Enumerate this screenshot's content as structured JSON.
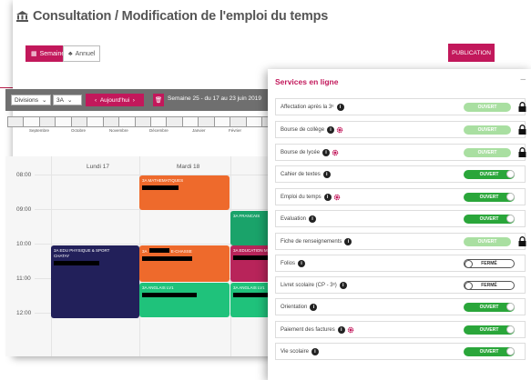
{
  "header": {
    "title": "Consultation / Modification de l'emploi du temps"
  },
  "view_toggle": {
    "week_label": "Semaine",
    "year_label": "Annuel"
  },
  "publish_label": "PUBLICATION",
  "toolbar": {
    "divisions_label": "Divisions",
    "class_value": "3A",
    "today_label": "Aujourd'hui",
    "week_text": "Semaine 25 - du 17 au 23 juin 2019"
  },
  "timeline": {
    "months": [
      "Septembre",
      "Octobre",
      "Novembre",
      "Décembre",
      "Janvier",
      "Février"
    ]
  },
  "calendar": {
    "days": [
      "Lundi 17",
      "Mardi 18"
    ],
    "hours": [
      "08:00",
      "09:00",
      "10:00",
      "11:00",
      "12:00"
    ],
    "events": [
      {
        "title": "3A MATHEMATIQUES",
        "color": "#ee6a2c"
      },
      {
        "title": "3A FRANCAIS",
        "color": "#1aa36a"
      },
      {
        "title": "3A EDU PHYSIQUE & SPORT",
        "sub": "CHATAY",
        "color": "#22205a"
      },
      {
        "title": "3A",
        "sub": "E-CHASSE",
        "color": "#ee6a2c"
      },
      {
        "title": "3A EDUCATION M",
        "color": "#b8245a"
      },
      {
        "title": "3A ANGLAIS LV1",
        "color": "#1fc27b"
      },
      {
        "title": "3A ANGLAIS LV1",
        "color": "#1fc27b"
      }
    ]
  },
  "panel": {
    "title": "Services en ligne",
    "services": [
      {
        "name": "Affectation après la 3ᵉ",
        "info": true,
        "gear": false,
        "status": "OUVERT",
        "state": "locked"
      },
      {
        "name": "Bourse de collège",
        "info": true,
        "gear": true,
        "status": "OUVERT",
        "state": "locked"
      },
      {
        "name": "Bourse de lycée",
        "info": true,
        "gear": true,
        "status": "OUVERT",
        "state": "locked"
      },
      {
        "name": "Cahier de textes",
        "info": true,
        "gear": false,
        "status": "OUVERT",
        "state": "open"
      },
      {
        "name": "Emploi du temps",
        "info": true,
        "gear": true,
        "status": "OUVERT",
        "state": "open"
      },
      {
        "name": "Evaluation",
        "info": true,
        "gear": false,
        "status": "OUVERT",
        "state": "open"
      },
      {
        "name": "Fiche de renseignements",
        "info": true,
        "gear": false,
        "status": "OUVERT",
        "state": "locked"
      },
      {
        "name": "Folios",
        "info": true,
        "gear": false,
        "status": "FERMÉ",
        "state": "closed"
      },
      {
        "name": "Livret scolaire (CP - 3ᵉ)",
        "info": true,
        "gear": false,
        "status": "FERMÉ",
        "state": "closed"
      },
      {
        "name": "Orientation",
        "info": true,
        "gear": false,
        "status": "OUVERT",
        "state": "open"
      },
      {
        "name": "Paiement des factures",
        "info": true,
        "gear": true,
        "status": "OUVERT",
        "state": "open"
      },
      {
        "name": "Vie scolaire",
        "info": true,
        "gear": false,
        "status": "OUVERT",
        "state": "open"
      }
    ]
  },
  "colors": {
    "accent": "#c2185b",
    "open": "#2aa63a",
    "locked": "#a9dfa1"
  }
}
